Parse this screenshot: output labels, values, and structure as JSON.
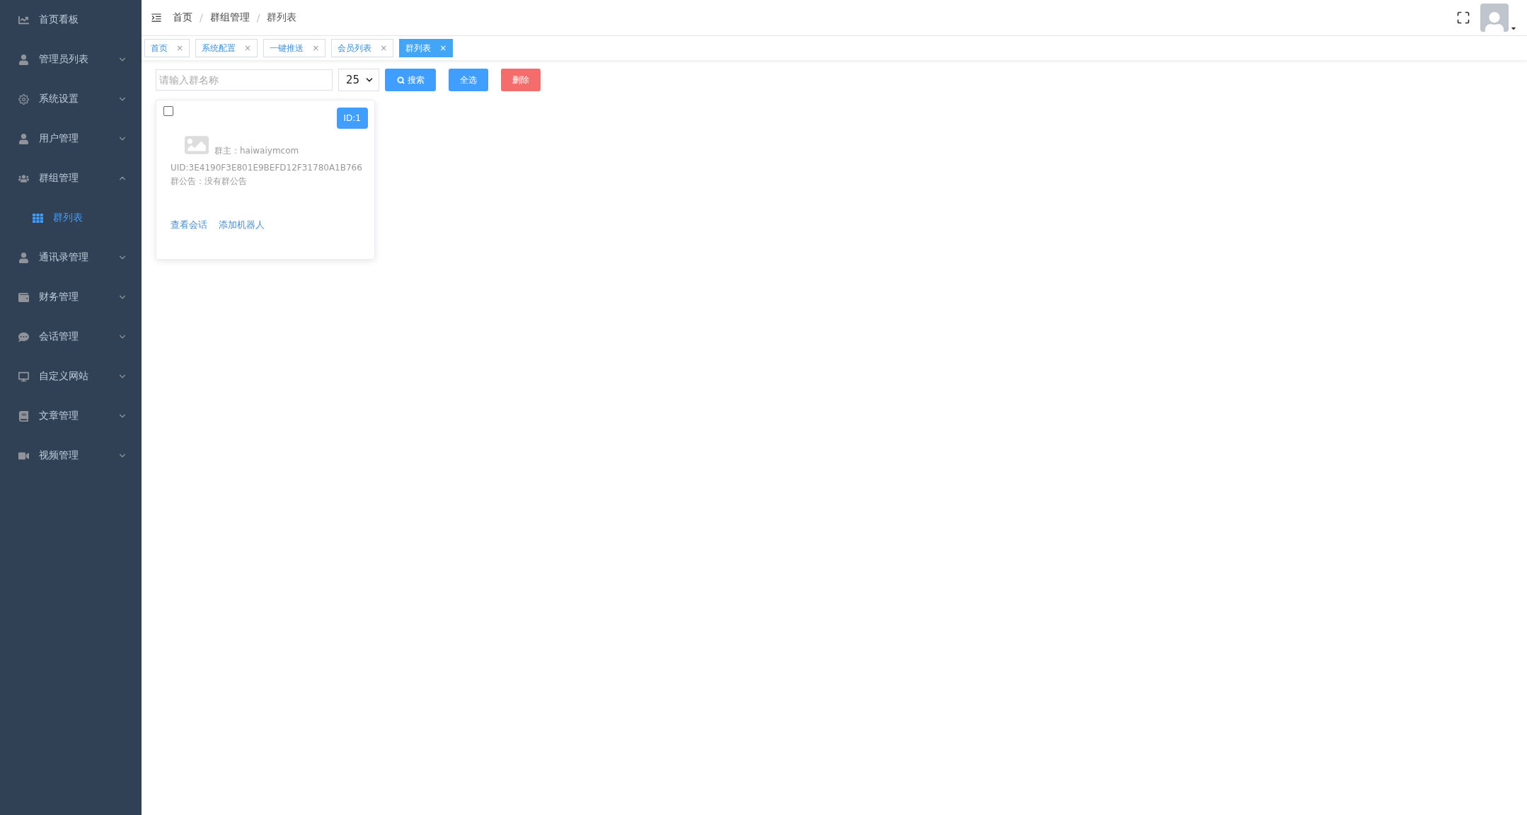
{
  "sidebar": {
    "items": [
      {
        "label": "首页看板",
        "kind": "link"
      },
      {
        "label": "管理员列表",
        "kind": "group",
        "expanded": false
      },
      {
        "label": "系统设置",
        "kind": "group",
        "expanded": false
      },
      {
        "label": "用户管理",
        "kind": "group",
        "expanded": false
      },
      {
        "label": "群组管理",
        "kind": "group",
        "expanded": true,
        "children": [
          {
            "label": "群列表",
            "selected": true
          }
        ]
      },
      {
        "label": "通讯录管理",
        "kind": "group",
        "expanded": false
      },
      {
        "label": "财务管理",
        "kind": "group",
        "expanded": false
      },
      {
        "label": "会话管理",
        "kind": "group",
        "expanded": false
      },
      {
        "label": "自定义网站",
        "kind": "group",
        "expanded": false
      },
      {
        "label": "文章管理",
        "kind": "group",
        "expanded": false
      },
      {
        "label": "视频管理",
        "kind": "group",
        "expanded": false
      }
    ]
  },
  "breadcrumb": {
    "items": [
      "首页",
      "群组管理",
      "群列表"
    ],
    "separators": [
      "/",
      "/"
    ]
  },
  "tabs": [
    {
      "label": "首页",
      "selected": false,
      "close": "×"
    },
    {
      "label": "系统配置",
      "selected": false,
      "close": "×"
    },
    {
      "label": "一键推送",
      "selected": false,
      "close": "×"
    },
    {
      "label": "会员列表",
      "selected": false,
      "close": "×"
    },
    {
      "label": "群列表",
      "selected": true,
      "close": "×"
    }
  ],
  "toolbar": {
    "search": {
      "placeholder": "请输入群名称"
    },
    "page_size": "25",
    "buttons": [
      {
        "label": "搜索",
        "kind": "search"
      },
      {
        "label": "全选",
        "kind": "primary"
      },
      {
        "label": "删除",
        "kind": "danger"
      }
    ]
  },
  "cards": [
    {
      "checked": false,
      "id": "ID:1",
      "owner": "群主：haiwaiymcom",
      "uid": "UID:3E4190F3E801E9BEFD12F31780A1B766",
      "notice": "群公告：没有群公告",
      "links": [
        "查看会话",
        "添加机器人"
      ]
    }
  ]
}
